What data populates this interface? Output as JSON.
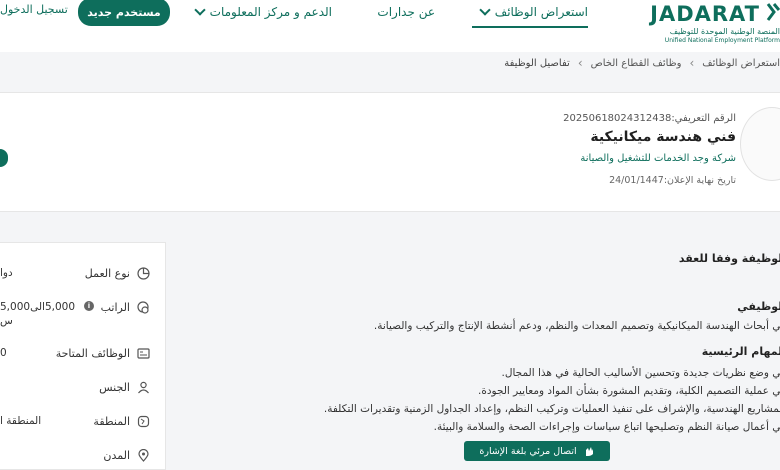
{
  "brand": {
    "latin": "JADARAT",
    "arabic": "المنصة الوطنية الموحدة للتوظيف",
    "english": "Unified National Employment Platform"
  },
  "nav": {
    "browse_jobs": "استعراض الوظائف",
    "about": "عن جدارات",
    "support": "الدعم و مركز المعلومات"
  },
  "auth": {
    "new_user": "مستخدم جديد",
    "login": "تسجيل الدخول"
  },
  "breadcrumb": {
    "browse": "استعراض الوظائف",
    "private_sector": "وظائف القطاع الخاص",
    "current": "تفاصيل الوظيفة"
  },
  "job": {
    "reference_label": "الرقم التعريفي:",
    "reference_value": "20250618024312438",
    "title": "فني هندسة ميكانيكية",
    "company": "شركة وجد الخدمات للتشغيل والصيانة",
    "deadline_label": "تاريخ نهاية الإعلان:",
    "deadline_value": "24/01/1447"
  },
  "description": {
    "contract_heading": "الوظيفة وفقا للعقد",
    "summary_heading": "الوظيفي",
    "summary_text": "في أبحاث الهندسة الميكانيكية وتصميم المعدات والنظم، ودعم أنشطة الإنتاج والتركيب والصيانة.",
    "tasks_heading": "المهام الرئيسية",
    "tasks": [
      "في وضع نظريات جديدة وتحسين الأساليب الحالية في هذا المجال.",
      "في عملية التصميم الكلية، وتقديم المشورة بشأن المواد ومعايير الجودة.",
      "للمشاريع الهندسية، والإشراف على تنفيذ العمليات وتركيب النظم، وإعداد الجداول الزمنية وتقديرات التكلفة.",
      "في أعمال صيانة النظم وتصليحها اتباع سياسات وإجراءات الصحة والسلامة والبيئة."
    ],
    "sign_language_button": "اتصال مرئي بلغة الإشارة"
  },
  "side_panel": {
    "rows": [
      {
        "label": "نوع العمل",
        "value": "دوا"
      },
      {
        "label": "الراتب",
        "value": "5,000الى5,000"
      },
      {
        "label": "الوظائف المتاحة",
        "value": "0"
      },
      {
        "label": "الجنس",
        "value": ""
      },
      {
        "label": "المنطقة",
        "value": "المنطقة ا"
      },
      {
        "label": "المدن",
        "value": ""
      }
    ],
    "salary_currency_fragment": "س"
  },
  "colors": {
    "brand_green": "#0e6e5c"
  }
}
